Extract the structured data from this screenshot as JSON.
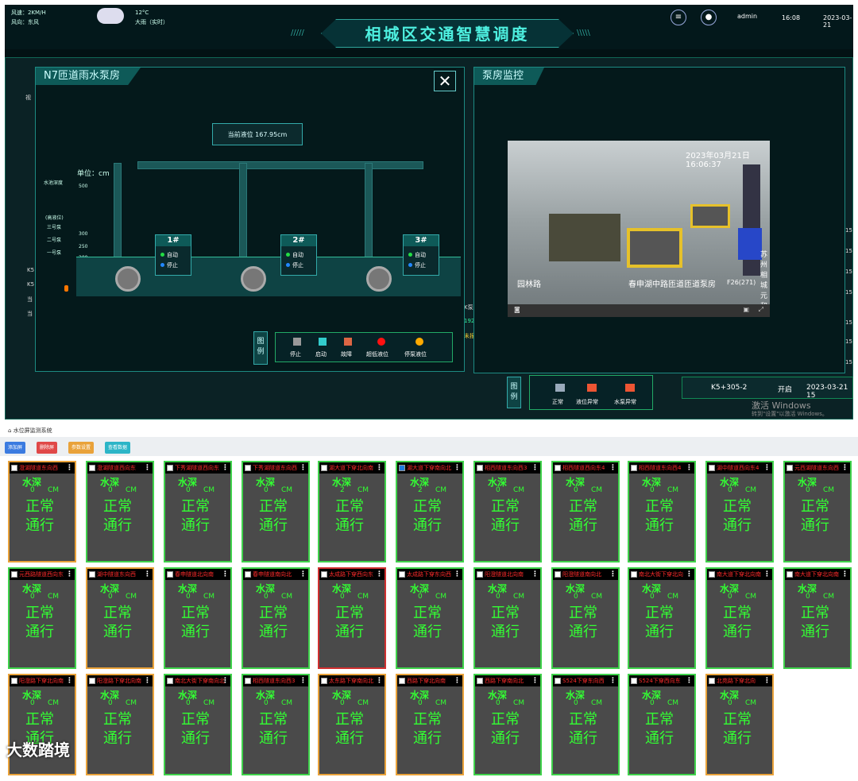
{
  "header": {
    "wind_speed": "风速：2KM/H",
    "wind_dir": "风向：东风",
    "temp": "12°C",
    "weather": "大雨（实时）",
    "title": "相城区交通智慧调度",
    "user": "admin",
    "time": "16:08",
    "date": "2023-03-21"
  },
  "pump_panel": {
    "title": "N7匝道雨水泵房",
    "close": "✕",
    "current_level": "当前液位 167.95cm",
    "unit": "单位：cm",
    "side_labels": [
      "水池深度",
      "(高液位)",
      "三号泵",
      "二号泵",
      "一号泵"
    ],
    "scale": [
      "500",
      "300",
      "250",
      "200"
    ],
    "pumps": [
      {
        "name": "1#",
        "auto": "自动",
        "stop": "停止"
      },
      {
        "name": "2#",
        "auto": "自动",
        "stop": "停止"
      },
      {
        "name": "3#",
        "auto": "自动",
        "stop": "停止"
      }
    ],
    "legend_btn": "图例",
    "legend": [
      "停止",
      "启动",
      "故障",
      "超低液位",
      "停泵液位"
    ]
  },
  "camera_panel": {
    "title": "泵房监控",
    "overlay_date": "2023年03月21日  16:06:37",
    "overlay_loc": "春申湖中路匝道匝道泵房",
    "overlay_tag": "苏州 相城 元和",
    "overlay_code": "F26(271)",
    "overlay_left": "园林路",
    "legend_btn": "图例",
    "legend": [
      "正常",
      "液位异常",
      "水泵异常"
    ]
  },
  "bg_table": {
    "row_code": "K5+305-2",
    "row_state": "开启",
    "row_date": "2023-03-21 15",
    "left_rows": [
      "K5",
      "K5",
      "当",
      "当"
    ],
    "right_col": [
      "15",
      "15",
      "15",
      "15",
      "15",
      "15",
      "15"
    ],
    "mid_labels": [
      "K泵",
      "192.",
      "未报",
      "视"
    ],
    "win_activate": "激活 Windows",
    "win_hint": "转到\"设置\"以激活 Windows。"
  },
  "system": {
    "breadcrumb": "水位屏监测系统",
    "buttons": [
      "添加屏",
      "删除屏",
      "参数设置",
      "查看数据"
    ],
    "buttons_colors": [
      "#3b7be0",
      "#e04848",
      "#e9a23a",
      "#2cb5c7"
    ],
    "depth_label": "水深",
    "unit": "CM",
    "status1": "正常",
    "status2": "通行",
    "cards": [
      {
        "name": "澄湖隧道东向西",
        "depth": "0",
        "border": "orange",
        "checked": false
      },
      {
        "name": "澄湖隧道西向东",
        "depth": "0",
        "border": "green",
        "checked": false
      },
      {
        "name": "下秀湖隧道西向东",
        "depth": "0",
        "border": "green",
        "checked": false
      },
      {
        "name": "下秀湖隧道东向西",
        "depth": "0",
        "border": "green",
        "checked": false
      },
      {
        "name": "湖大道下穿北向南",
        "depth": "2",
        "border": "green",
        "checked": false
      },
      {
        "name": "湖大道下穿南向北",
        "depth": "2",
        "border": "green",
        "checked": true
      },
      {
        "name": "相西隧道东向西3",
        "depth": "0",
        "border": "green",
        "checked": false
      },
      {
        "name": "相西隧道西向东4",
        "depth": "0",
        "border": "green",
        "checked": false
      },
      {
        "name": "相西隧道东向西4",
        "depth": "0",
        "border": "green",
        "checked": false
      },
      {
        "name": "湖中隧道西向东4",
        "depth": "0",
        "border": "green",
        "checked": false
      },
      {
        "name": "元西湖隧道东向西",
        "depth": "0",
        "border": "green",
        "checked": false
      },
      {
        "name": "元西路隧道西向东",
        "depth": "0",
        "border": "green",
        "checked": false
      },
      {
        "name": "湖中隧道东向西",
        "depth": "0",
        "border": "orange",
        "checked": false
      },
      {
        "name": "春申隧道北向南",
        "depth": "0",
        "border": "green",
        "checked": false
      },
      {
        "name": "春申隧道南向北",
        "depth": "0",
        "border": "green",
        "checked": false
      },
      {
        "name": "太成路下穿西向东",
        "depth": "0",
        "border": "red",
        "checked": false
      },
      {
        "name": "太成路下穿东向西",
        "depth": "0",
        "border": "green",
        "checked": false
      },
      {
        "name": "阳澄隧道北向南",
        "depth": "0",
        "border": "green",
        "checked": false
      },
      {
        "name": "阳澄隧道南向北",
        "depth": "0",
        "border": "green",
        "checked": false
      },
      {
        "name": "南北大街下穿北向",
        "depth": "0",
        "border": "green",
        "checked": false
      },
      {
        "name": "南大道下穿北向南",
        "depth": "0",
        "border": "green",
        "checked": false
      },
      {
        "name": "南大道下穿北向南",
        "depth": "0",
        "border": "green",
        "checked": false
      },
      {
        "name": "阳澄路下穿北向南",
        "depth": "0",
        "border": "orange",
        "checked": false
      },
      {
        "name": "阳澄路下穿北向南",
        "depth": "0",
        "border": "orange",
        "checked": false
      },
      {
        "name": "南北大街下穿南向北",
        "depth": "0",
        "border": "green",
        "checked": false
      },
      {
        "name": "相西隧道东向西3",
        "depth": "0",
        "border": "green",
        "checked": false
      },
      {
        "name": "太东路下穿南向北",
        "depth": "0",
        "border": "orange",
        "checked": false
      },
      {
        "name": "西路下穿北向南",
        "depth": "0",
        "border": "orange",
        "checked": false
      },
      {
        "name": "西路下穿南向北",
        "depth": "0",
        "border": "green",
        "checked": false
      },
      {
        "name": "S524下穿东向西",
        "depth": "0",
        "border": "green",
        "checked": false
      },
      {
        "name": "S524下穿西向东",
        "depth": "0",
        "border": "green",
        "checked": false
      },
      {
        "name": "北苑路下穿北向",
        "depth": "0",
        "border": "orange",
        "checked": false
      }
    ]
  },
  "watermark": "大数踏境"
}
